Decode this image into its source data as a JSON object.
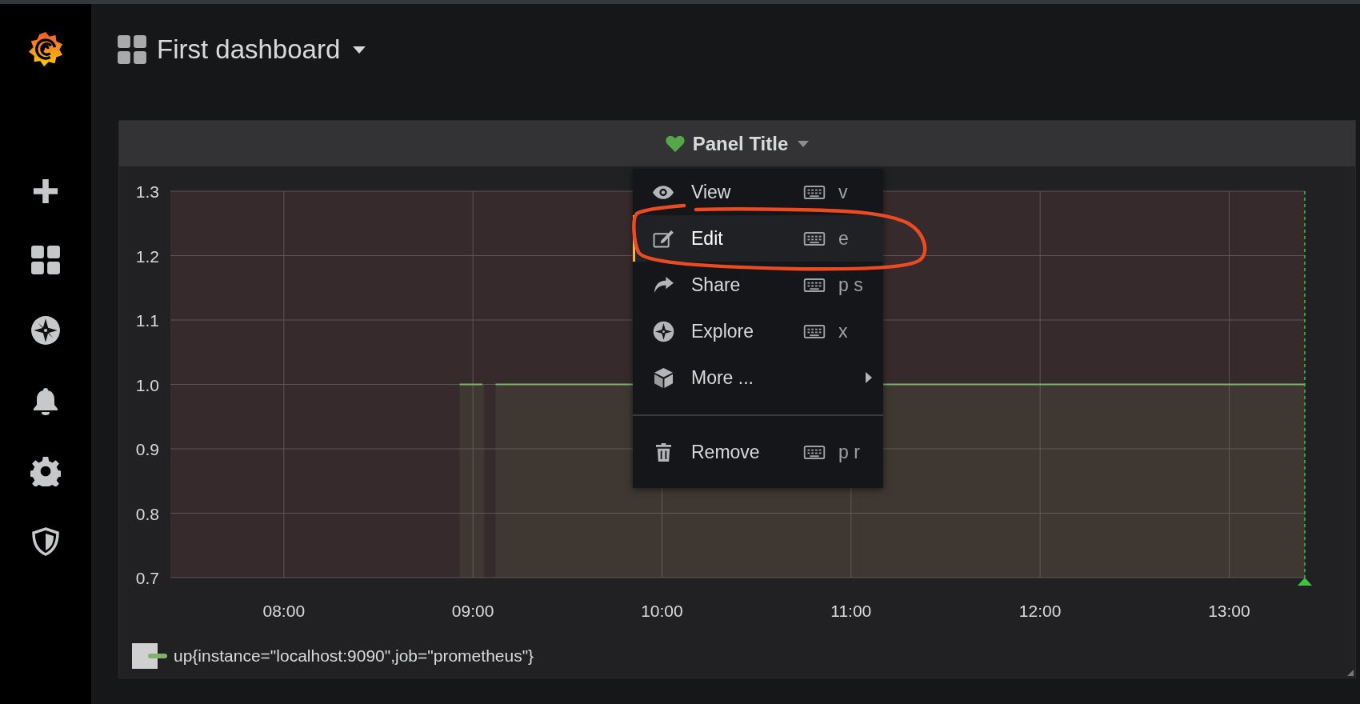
{
  "dashboard": {
    "title": "First dashboard"
  },
  "panel": {
    "title": "Panel Title",
    "menu": {
      "items": [
        {
          "label": "View",
          "shortcut": "v",
          "kind": "action",
          "selected": false
        },
        {
          "label": "Edit",
          "shortcut": "e",
          "kind": "action",
          "selected": true
        },
        {
          "label": "Share",
          "shortcut": "p s",
          "kind": "action",
          "selected": false
        },
        {
          "label": "Explore",
          "shortcut": "x",
          "kind": "action",
          "selected": false
        },
        {
          "label": "More ...",
          "kind": "submenu",
          "selected": false
        }
      ],
      "bottom_items": [
        {
          "label": "Remove",
          "shortcut": "p r",
          "kind": "action",
          "selected": false
        }
      ]
    },
    "chart_data": {
      "type": "area",
      "grid": true,
      "xlim": [
        7.4,
        13.4
      ],
      "ylim": [
        0.7,
        1.3
      ],
      "xticks": [
        {
          "value": 8,
          "label": "08:00"
        },
        {
          "value": 9,
          "label": "09:00"
        },
        {
          "value": 10,
          "label": "10:00"
        },
        {
          "value": 11,
          "label": "11:00"
        },
        {
          "value": 12,
          "label": "12:00"
        },
        {
          "value": 13,
          "label": "13:00"
        }
      ],
      "yticks": [
        {
          "value": 1.3,
          "label": "1.3"
        },
        {
          "value": 1.2,
          "label": "1.2"
        },
        {
          "value": 1.1,
          "label": "1.1"
        },
        {
          "value": 1.0,
          "label": "1.0"
        },
        {
          "value": 0.9,
          "label": "0.9"
        },
        {
          "value": 0.8,
          "label": "0.8"
        },
        {
          "value": 0.7,
          "label": "0.7"
        }
      ],
      "x": [
        8.93,
        9.05,
        9.06,
        9.12,
        13.4
      ],
      "series": [
        {
          "name": "up{instance=\"localhost:9090\",job=\"prometheus\"}",
          "color": "#7eb26d",
          "values": [
            1,
            1,
            null,
            1,
            1
          ]
        }
      ]
    }
  }
}
